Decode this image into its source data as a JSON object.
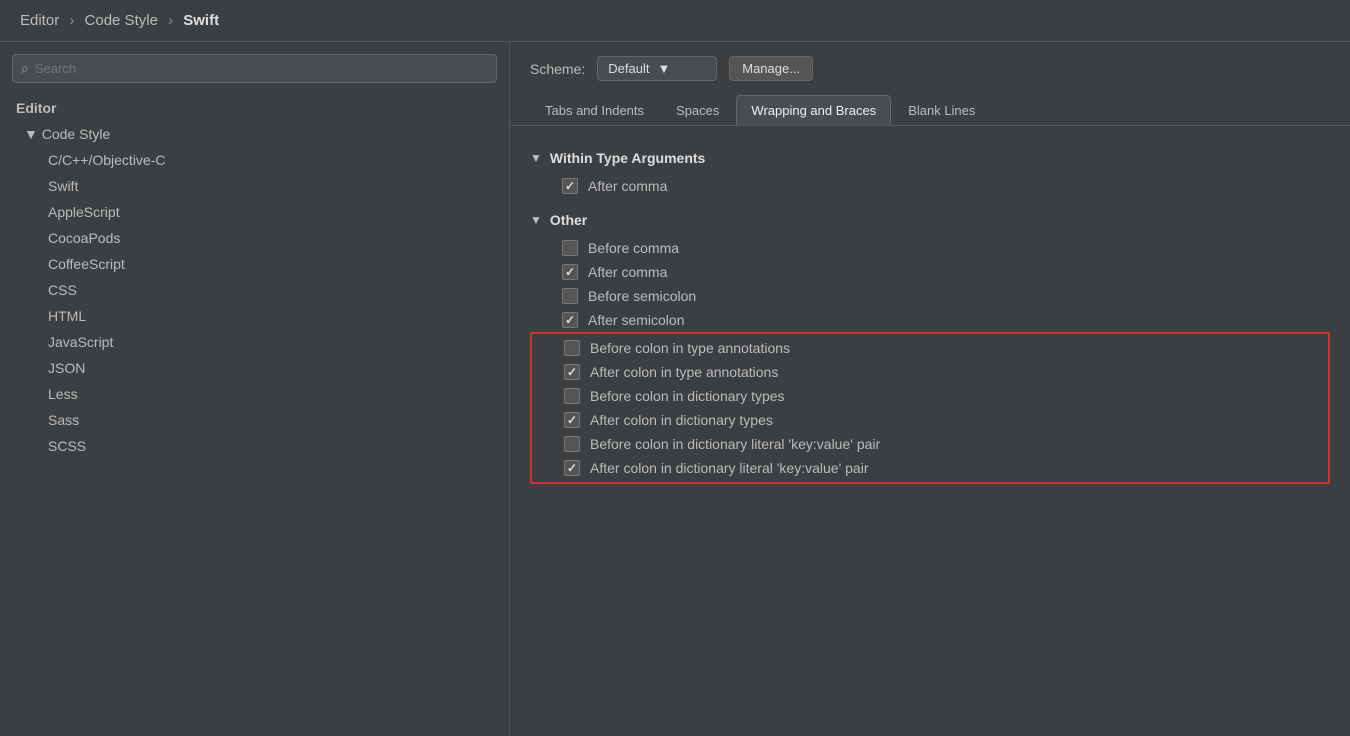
{
  "header": {
    "breadcrumb": [
      "Editor",
      "Code Style",
      "Swift"
    ]
  },
  "sidebar": {
    "search_placeholder": "Search",
    "sections": [
      {
        "id": "editor",
        "label": "Editor",
        "type": "section"
      },
      {
        "id": "code-style",
        "label": "Code Style",
        "type": "subsection",
        "expanded": true
      },
      {
        "id": "cpp",
        "label": "C/C++/Objective-C",
        "type": "child"
      },
      {
        "id": "swift",
        "label": "Swift",
        "type": "child",
        "active": true
      },
      {
        "id": "applescript",
        "label": "AppleScript",
        "type": "child"
      },
      {
        "id": "cocoapods",
        "label": "CocoaPods",
        "type": "child"
      },
      {
        "id": "coffeescript",
        "label": "CoffeeScript",
        "type": "child"
      },
      {
        "id": "css",
        "label": "CSS",
        "type": "child"
      },
      {
        "id": "html",
        "label": "HTML",
        "type": "child"
      },
      {
        "id": "javascript",
        "label": "JavaScript",
        "type": "child"
      },
      {
        "id": "json",
        "label": "JSON",
        "type": "child"
      },
      {
        "id": "less",
        "label": "Less",
        "type": "child"
      },
      {
        "id": "sass",
        "label": "Sass",
        "type": "child"
      },
      {
        "id": "scss",
        "label": "SCSS",
        "type": "child"
      }
    ]
  },
  "content": {
    "scheme_label": "Scheme:",
    "scheme_value": "Default",
    "manage_label": "Manage...",
    "tabs": [
      {
        "id": "tabs-indents",
        "label": "Tabs and Indents",
        "active": false
      },
      {
        "id": "spaces",
        "label": "Spaces",
        "active": false
      },
      {
        "id": "wrapping",
        "label": "Wrapping and Braces",
        "active": true
      },
      {
        "id": "blank-lines",
        "label": "Blank Lines",
        "active": false
      }
    ],
    "sections": [
      {
        "id": "within-type-args",
        "title": "Within Type Arguments",
        "expanded": true,
        "items": [
          {
            "id": "after-comma-1",
            "label": "After comma",
            "checked": true
          }
        ]
      },
      {
        "id": "other",
        "title": "Other",
        "expanded": true,
        "items": [
          {
            "id": "before-comma",
            "label": "Before comma",
            "checked": false
          },
          {
            "id": "after-comma-2",
            "label": "After comma",
            "checked": true
          },
          {
            "id": "before-semicolon",
            "label": "Before semicolon",
            "checked": false
          },
          {
            "id": "after-semicolon",
            "label": "After semicolon",
            "checked": true
          }
        ],
        "highlighted_items": [
          {
            "id": "before-colon-type",
            "label": "Before colon in type annotations",
            "checked": false
          },
          {
            "id": "after-colon-type",
            "label": "After colon in type annotations",
            "checked": true
          },
          {
            "id": "before-colon-dict",
            "label": "Before colon in dictionary types",
            "checked": false
          },
          {
            "id": "after-colon-dict",
            "label": "After colon in dictionary types",
            "checked": true
          },
          {
            "id": "before-colon-literal",
            "label": "Before colon in dictionary literal 'key:value' pair",
            "checked": false
          },
          {
            "id": "after-colon-literal",
            "label": "After colon in dictionary literal 'key:value' pair",
            "checked": true
          }
        ]
      }
    ]
  }
}
